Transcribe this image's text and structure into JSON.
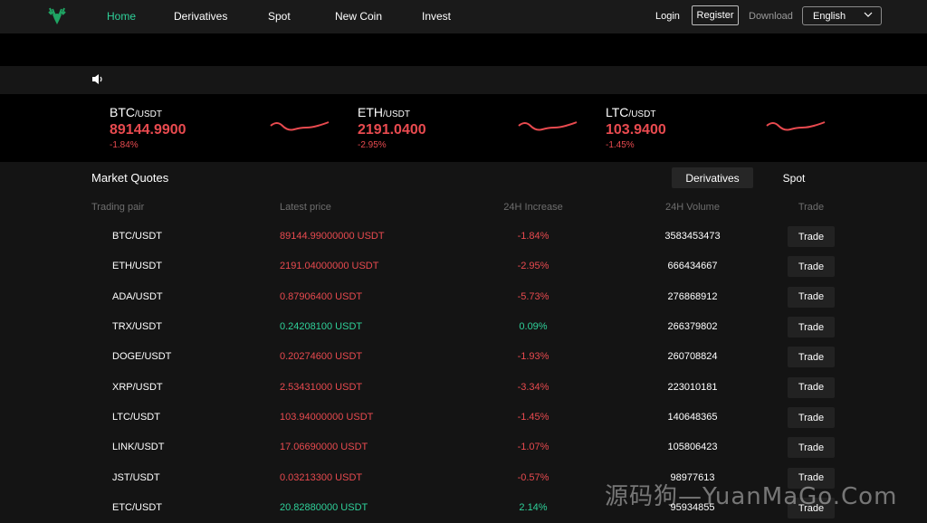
{
  "nav": {
    "logo": "deer-logo-icon",
    "items": [
      {
        "label": "Home",
        "active": true
      },
      {
        "label": "Derivatives"
      },
      {
        "label": "Spot"
      },
      {
        "label": "New Coin"
      },
      {
        "label": "Invest"
      }
    ],
    "login": "Login",
    "register": "Register",
    "download": "Download",
    "language": "English"
  },
  "tickers": [
    {
      "base": "BTC",
      "quote": "/USDT",
      "price": "89144.9900",
      "change": "-1.84%"
    },
    {
      "base": "ETH",
      "quote": "/USDT",
      "price": "2191.0400",
      "change": "-2.95%"
    },
    {
      "base": "LTC",
      "quote": "/USDT",
      "price": "103.9400",
      "change": "-1.45%"
    }
  ],
  "market": {
    "title": "Market Quotes",
    "tabs": [
      "Derivatives",
      "Spot"
    ],
    "active_tab": "Derivatives",
    "columns": [
      "Trading pair",
      "Latest price",
      "24H Increase",
      "24H Volume",
      "Trade"
    ],
    "rows": [
      {
        "pair": "BTC/USDT",
        "price": "89144.99000000 USDT",
        "change": "-1.84%",
        "volume": "3583453473",
        "trade": "Trade"
      },
      {
        "pair": "ETH/USDT",
        "price": "2191.04000000 USDT",
        "change": "-2.95%",
        "volume": "666434667",
        "trade": "Trade"
      },
      {
        "pair": "ADA/USDT",
        "price": "0.87906400 USDT",
        "change": "-5.73%",
        "volume": "276868912",
        "trade": "Trade"
      },
      {
        "pair": "TRX/USDT",
        "price": "0.24208100 USDT",
        "change": "0.09%",
        "volume": "266379802",
        "trade": "Trade"
      },
      {
        "pair": "DOGE/USDT",
        "price": "0.20274600 USDT",
        "change": "-1.93%",
        "volume": "260708824",
        "trade": "Trade"
      },
      {
        "pair": "XRP/USDT",
        "price": "2.53431000 USDT",
        "change": "-3.34%",
        "volume": "223010181",
        "trade": "Trade"
      },
      {
        "pair": "LTC/USDT",
        "price": "103.94000000 USDT",
        "change": "-1.45%",
        "volume": "140648365",
        "trade": "Trade"
      },
      {
        "pair": "LINK/USDT",
        "price": "17.06690000 USDT",
        "change": "-1.07%",
        "volume": "105806423",
        "trade": "Trade"
      },
      {
        "pair": "JST/USDT",
        "price": "0.03213300 USDT",
        "change": "-0.57%",
        "volume": "98977613",
        "trade": "Trade"
      },
      {
        "pair": "ETC/USDT",
        "price": "20.82880000 USDT",
        "change": "2.14%",
        "volume": "95934855",
        "trade": "Trade"
      }
    ]
  },
  "watermark": "源码狗—YuanMaGo.Com",
  "colors": {
    "accent": "#2fd19a",
    "down": "#e84a4f",
    "up": "#2fd19a",
    "background": "#141414"
  }
}
